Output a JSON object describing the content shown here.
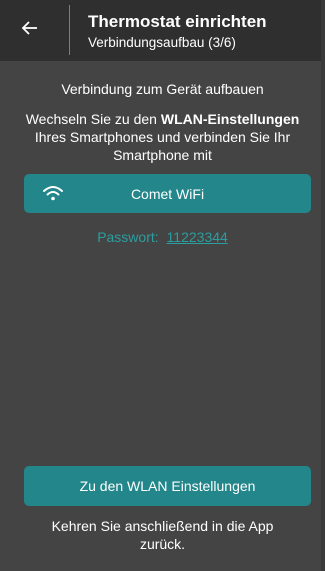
{
  "header": {
    "back_icon": "arrow-left-icon",
    "title": "Thermostat einrichten",
    "subtitle": "Verbindungsaufbau (3/6)"
  },
  "main": {
    "intro": "Verbindung zum Gerät aufbauen",
    "instructions_prefix": "Wechseln Sie zu den ",
    "instructions_bold": "WLAN-Einstellungen",
    "instructions_suffix": " Ihres Smartphones und verbinden Sie Ihr Smartphone mit",
    "wifi": {
      "icon": "wifi-icon",
      "name": "Comet WiFi"
    },
    "password_label": "Passwort:",
    "password_value": "11223344",
    "wlan_button_label": "Zu den WLAN Einstellungen",
    "footer_text": "Kehren Sie anschließend in die App zurück."
  },
  "colors": {
    "background": "#444444",
    "app_bar": "#2f2f2f",
    "accent": "#23868a",
    "password_text": "#2b9ea0"
  }
}
